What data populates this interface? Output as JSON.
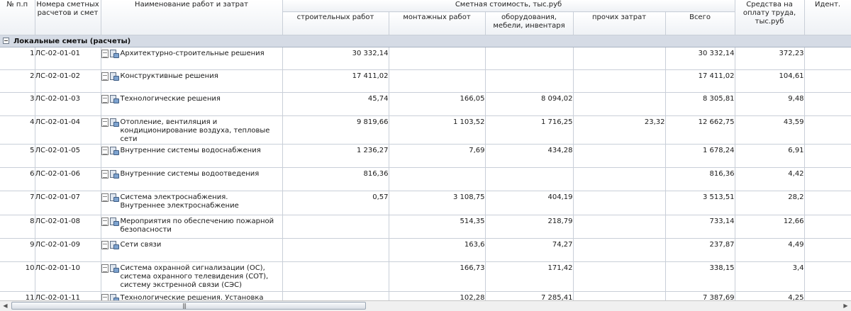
{
  "grid": {
    "headers": {
      "num": "№ п.п",
      "code": "Номера сметных расчетов и смет",
      "name": "Наименование работ и затрат",
      "cost_group": "Сметная стоимость, тыс.руб",
      "construction": "строительных работ",
      "installation": "монтажных работ",
      "equipment": "оборудования, мебели, инвентаря",
      "other": "прочих затрат",
      "total": "Всего",
      "wages": "Средства на оплату труда, тыс.руб",
      "ident": "Идент."
    },
    "group_label": "Локальные сметы (расчеты)",
    "rows": [
      {
        "n": "1",
        "code": "ЛС-02-01-01",
        "name": "Архитектурно-строительные решения",
        "construction": "30 332,14",
        "installation": "",
        "equipment": "",
        "other": "",
        "total": "30 332,14",
        "wages": "372,23",
        "ident": ""
      },
      {
        "n": "2",
        "code": "ЛС-02-01-02",
        "name": "Конструктивные решения",
        "construction": "17 411,02",
        "installation": "",
        "equipment": "",
        "other": "",
        "total": "17 411,02",
        "wages": "104,61",
        "ident": ""
      },
      {
        "n": "3",
        "code": "ЛС-02-01-03",
        "name": "Технологические решения",
        "construction": "45,74",
        "installation": "166,05",
        "equipment": "8 094,02",
        "other": "",
        "total": "8 305,81",
        "wages": "9,48",
        "ident": ""
      },
      {
        "n": "4",
        "code": "ЛС-02-01-04",
        "name": "Отопление, вентиляция и кондиционирование воздуха, тепловые сети",
        "construction": "9 819,66",
        "installation": "1 103,52",
        "equipment": "1 716,25",
        "other": "23,32",
        "total": "12 662,75",
        "wages": "43,59",
        "ident": ""
      },
      {
        "n": "5",
        "code": "ЛС-02-01-05",
        "name": "Внутренние системы водоснабжения",
        "construction": "1 236,27",
        "installation": "7,69",
        "equipment": "434,28",
        "other": "",
        "total": "1 678,24",
        "wages": "6,91",
        "ident": ""
      },
      {
        "n": "6",
        "code": "ЛС-02-01-06",
        "name": "Внутренние системы водоотведения",
        "construction": "816,36",
        "installation": "",
        "equipment": "",
        "other": "",
        "total": "816,36",
        "wages": "4,42",
        "ident": ""
      },
      {
        "n": "7",
        "code": "ЛС-02-01-07",
        "name": "Система электроснабжения. Внутреннее электроснабжение",
        "construction": "0,57",
        "installation": "3 108,75",
        "equipment": "404,19",
        "other": "",
        "total": "3 513,51",
        "wages": "28,2",
        "ident": ""
      },
      {
        "n": "8",
        "code": "ЛС-02-01-08",
        "name": "Мероприятия по обеспечению пожарной безопасности",
        "construction": "",
        "installation": "514,35",
        "equipment": "218,79",
        "other": "",
        "total": "733,14",
        "wages": "12,66",
        "ident": ""
      },
      {
        "n": "9",
        "code": "ЛС-02-01-09",
        "name": "Сети связи",
        "construction": "",
        "installation": "163,6",
        "equipment": "74,27",
        "other": "",
        "total": "237,87",
        "wages": "4,49",
        "ident": ""
      },
      {
        "n": "10",
        "code": "ЛС-02-01-10",
        "name": "Система охранной сигнализации (ОС), система охранного телевидения (СОТ), систему экстренной связи (СЭС)",
        "construction": "",
        "installation": "166,73",
        "equipment": "171,42",
        "other": "",
        "total": "338,15",
        "wages": "3,4",
        "ident": ""
      },
      {
        "n": "11",
        "code": "ЛС-02-01-11",
        "name": "Технологические решения. Установка лифта",
        "construction": "",
        "installation": "102,28",
        "equipment": "7 285,41",
        "other": "",
        "total": "7 387,69",
        "wages": "4,25",
        "ident": ""
      }
    ],
    "row_heights": [
      31,
      31,
      32,
      33,
      32,
      32,
      33,
      32,
      32,
      41,
      28
    ]
  },
  "scrollbar": {
    "left_arrow": "◀",
    "right_arrow": "▶",
    "grip": "|||"
  },
  "colors": {
    "group_band": "#d5dbe5",
    "grid_line": "#c9cfd8",
    "header_bg": "#eef1f5"
  }
}
